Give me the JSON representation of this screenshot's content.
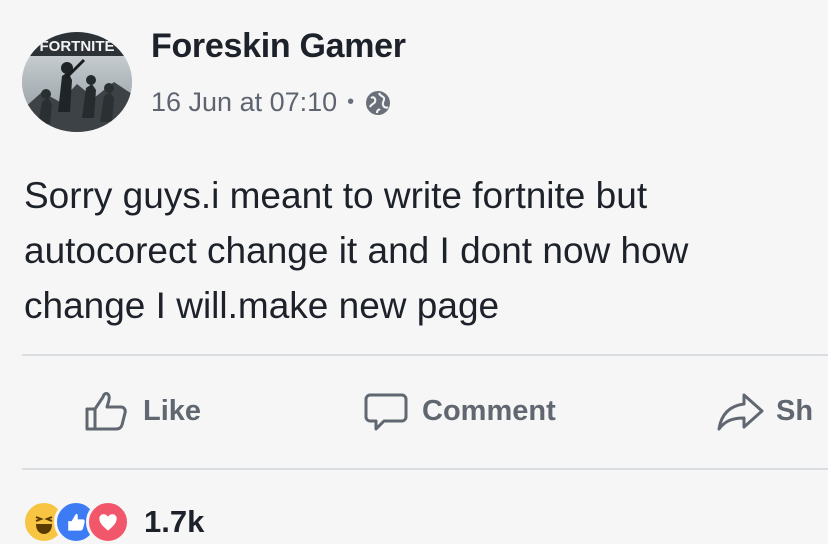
{
  "post": {
    "author_name": "Foreskin Gamer",
    "timestamp": "16 Jun at 07:10",
    "separator": "•",
    "privacy_icon": "globe-icon",
    "avatar_text": "FORTNITE",
    "text": "Sorry guys.i meant to write fortnite but\nautocorect change it and I dont now how\nchange I will.make new page"
  },
  "actions": {
    "like_label": "Like",
    "comment_label": "Comment",
    "share_label": "Sh"
  },
  "reactions": {
    "icons": [
      "haha-icon",
      "like-icon",
      "love-icon"
    ],
    "count": "1.7k"
  },
  "colors": {
    "background": "#f6f6f6",
    "text": "#1d2129",
    "secondary_text": "#606770",
    "like_blue": "#3d7bf5",
    "love_red": "#f2566b",
    "haha_yellow": "#f7c542"
  }
}
